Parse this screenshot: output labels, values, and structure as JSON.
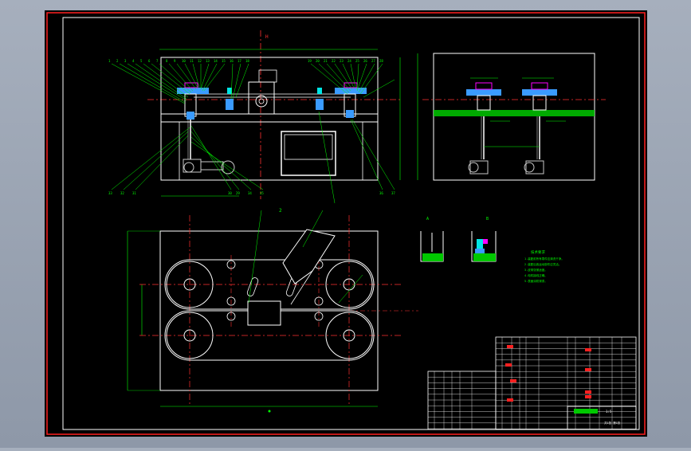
{
  "drawing": {
    "background": "#000000",
    "colors": {
      "border": "#ff2020",
      "frame": "#ffffff",
      "leader": "#00ff00",
      "centerline": "#ff3030",
      "dimension": "#00ff00",
      "part_blue": "#3a9bff",
      "part_cyan": "#00e5e5",
      "motor": "#c8c8c8",
      "text_yellow": "#ffff66",
      "text_magenta": "#ff00ff",
      "hatch": "#00c800"
    },
    "labels": {
      "dim_top": "H",
      "dim_mid": "2",
      "section_a": "A",
      "section_b": "B",
      "tech_req_title": "技术要求"
    },
    "tech_requirements": [
      "1.装配前所有零件应清洗干净。",
      "2.装配后各运动部件应灵活。",
      "3.皮带张紧适度。",
      "4.电机接线正确。",
      "5.表面涂防锈漆。"
    ],
    "title_block": {
      "scale": "1:5",
      "sheet": "共1张 第1张"
    }
  }
}
